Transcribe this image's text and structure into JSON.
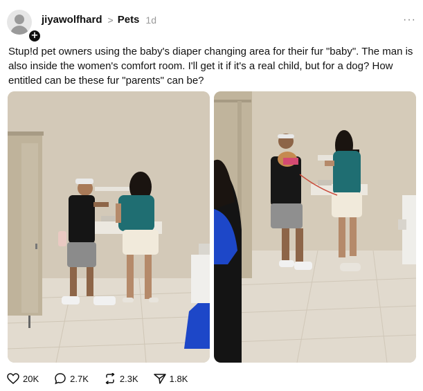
{
  "post": {
    "username": "jiyawolfhard",
    "breadcrumb_separator": ">",
    "community": "Pets",
    "time": "1d",
    "more_icon": "more-horizontal-icon",
    "text": "Stup!d pet owners using the baby's diaper changing area for their fur \"baby\". The man is also inside the women's comfort room. I'll get it if it's a real child, but for a dog? How entitled can be these fur \"parents\" can be?"
  },
  "images": [
    {
      "name": "restroom-photo-left"
    },
    {
      "name": "restroom-photo-right"
    }
  ],
  "actions": {
    "likes": "20K",
    "replies": "2.7K",
    "reposts": "2.3K",
    "shares": "1.8K"
  },
  "colors": {
    "wall": "#cfc4b2",
    "stall": "#c2b69f",
    "floor": "#e4ddd1",
    "shirt_teal": "#1f6e72",
    "blue_sleeve": "#1d47c8"
  }
}
